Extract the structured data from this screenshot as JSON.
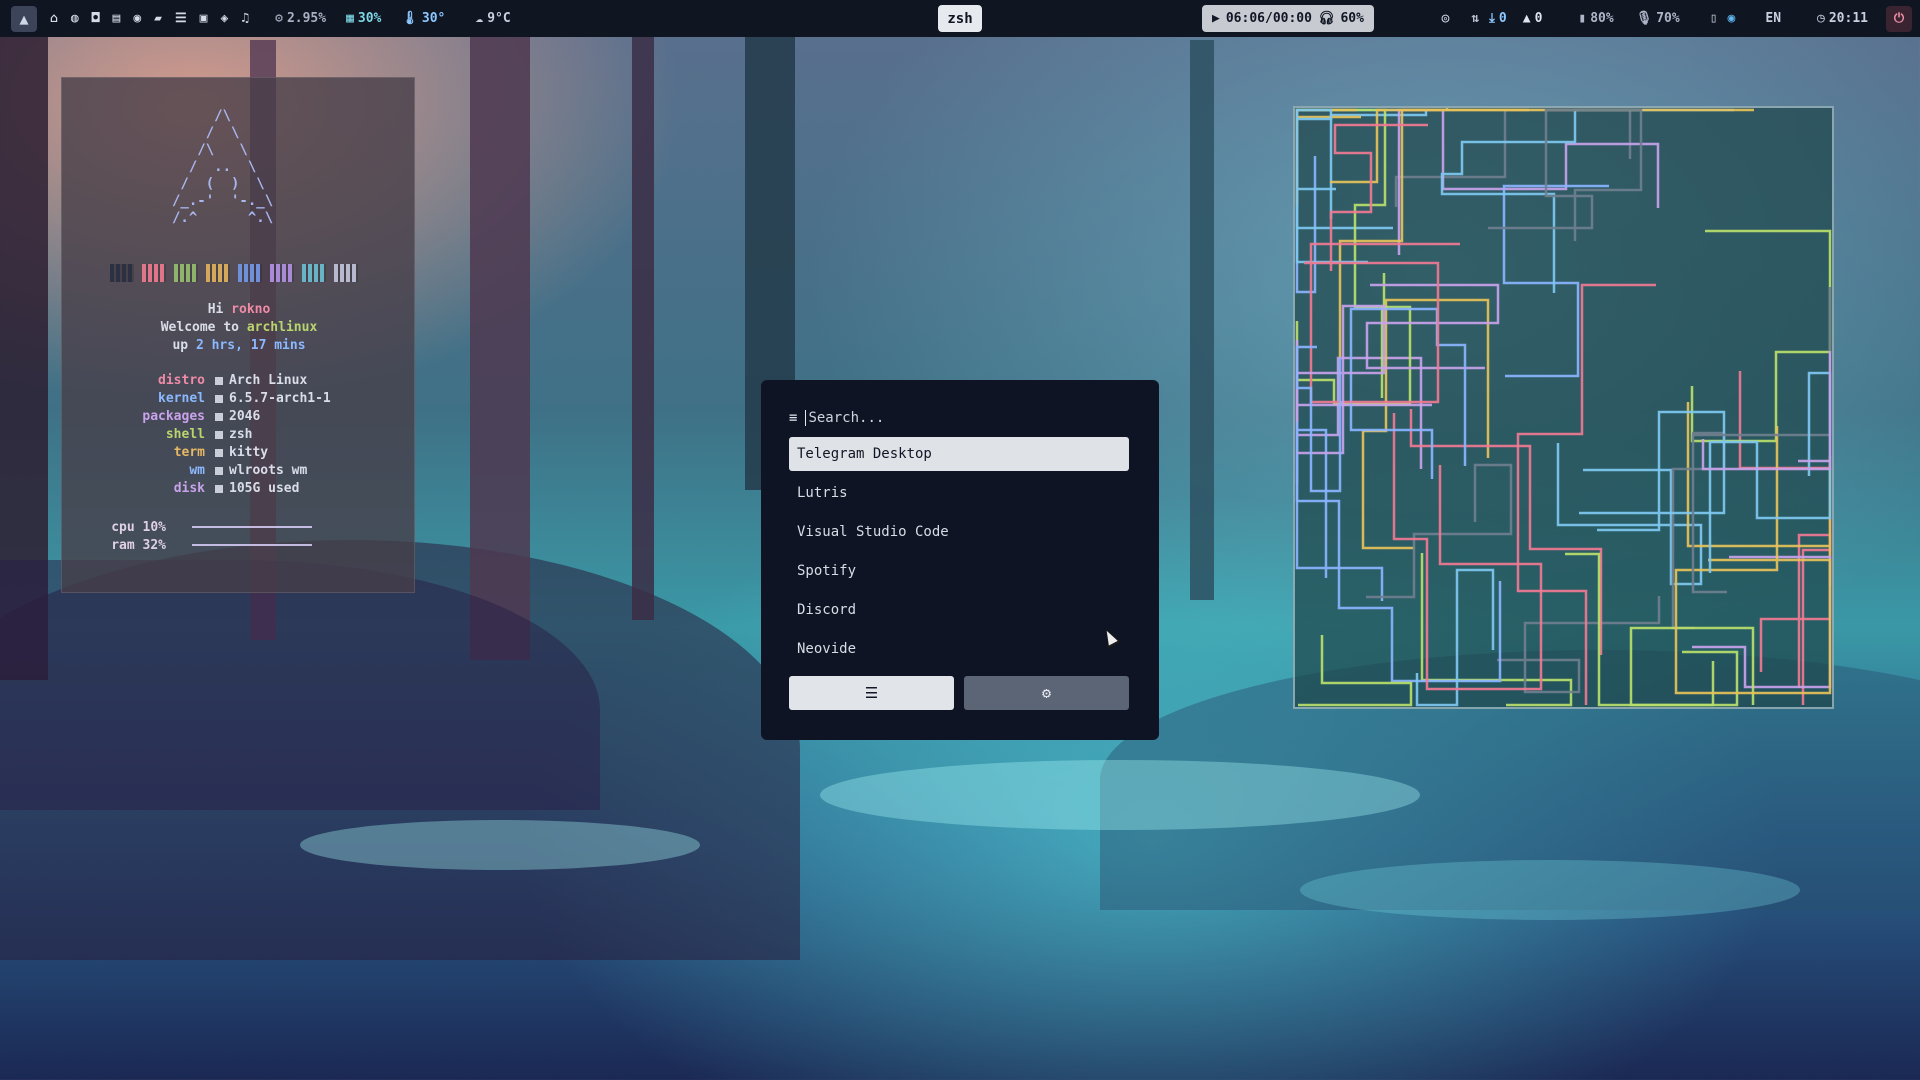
{
  "topbar": {
    "workspace_icons": [
      "home-icon",
      "globe-icon",
      "gamepad-icon",
      "notes-icon",
      "palette-icon",
      "folder-icon",
      "list-icon",
      "image-icon",
      "code-icon",
      "music-icon"
    ],
    "cpu": "2.95%",
    "memory": "30%",
    "temperature": "30°",
    "weather": "9°C",
    "active_window": "zsh",
    "media": {
      "time": "06:06/00:00",
      "volume": "60%"
    },
    "updates": "0",
    "arch_updates": "0",
    "battery": "80%",
    "mic": "70%",
    "language": "EN",
    "clock": "20:11"
  },
  "fetch": {
    "logo_art": "     /\\\n    /  \\\n   /\\   \\\n  /  ..  \\\n /  (  )  \\\n/_.-'  '-._\\\n/.^      ^.\\",
    "swatch_colors": [
      "#2b3142",
      "#e07489",
      "#8fb36a",
      "#d4a85a",
      "#6f8fd8",
      "#a88ad9",
      "#69b3c7",
      "#b7b9cf"
    ],
    "greeting": "Hi",
    "user": "rokno",
    "welcome": "Welcome to",
    "os_short": "archlinux",
    "uptime_prefix": "up",
    "uptime": "2 hrs, 17 mins",
    "info": [
      {
        "key": "distro",
        "value": "Arch Linux",
        "color": "#ef8ba7"
      },
      {
        "key": "kernel",
        "value": "6.5.7-arch1-1",
        "color": "#8cb8ff"
      },
      {
        "key": "packages",
        "value": "2046",
        "color": "#c8a2ea"
      },
      {
        "key": "shell",
        "value": "zsh",
        "color": "#b9d56f"
      },
      {
        "key": "term",
        "value": "kitty",
        "color": "#e7b863"
      },
      {
        "key": "wm",
        "value": "wlroots wm",
        "color": "#8cb8ff"
      },
      {
        "key": "disk",
        "value": "105G used",
        "color": "#c8a2ea"
      }
    ],
    "cpu_label": "cpu 10%",
    "ram_label": "ram 32%"
  },
  "launcher": {
    "search_placeholder": "Search...",
    "items": [
      "Telegram Desktop",
      "Lutris",
      "Visual Studio Code",
      "Spotify",
      "Discord",
      "Neovide"
    ],
    "selected_index": 0,
    "buttons": [
      "menu-icon",
      "gear-icon"
    ]
  },
  "pipes_window": {
    "palette": [
      "#7ec8f0",
      "#f07a93",
      "#c8a2ea",
      "#b9e06b",
      "#e7c25a",
      "#8ab4ff",
      "#6f7f8f"
    ]
  }
}
